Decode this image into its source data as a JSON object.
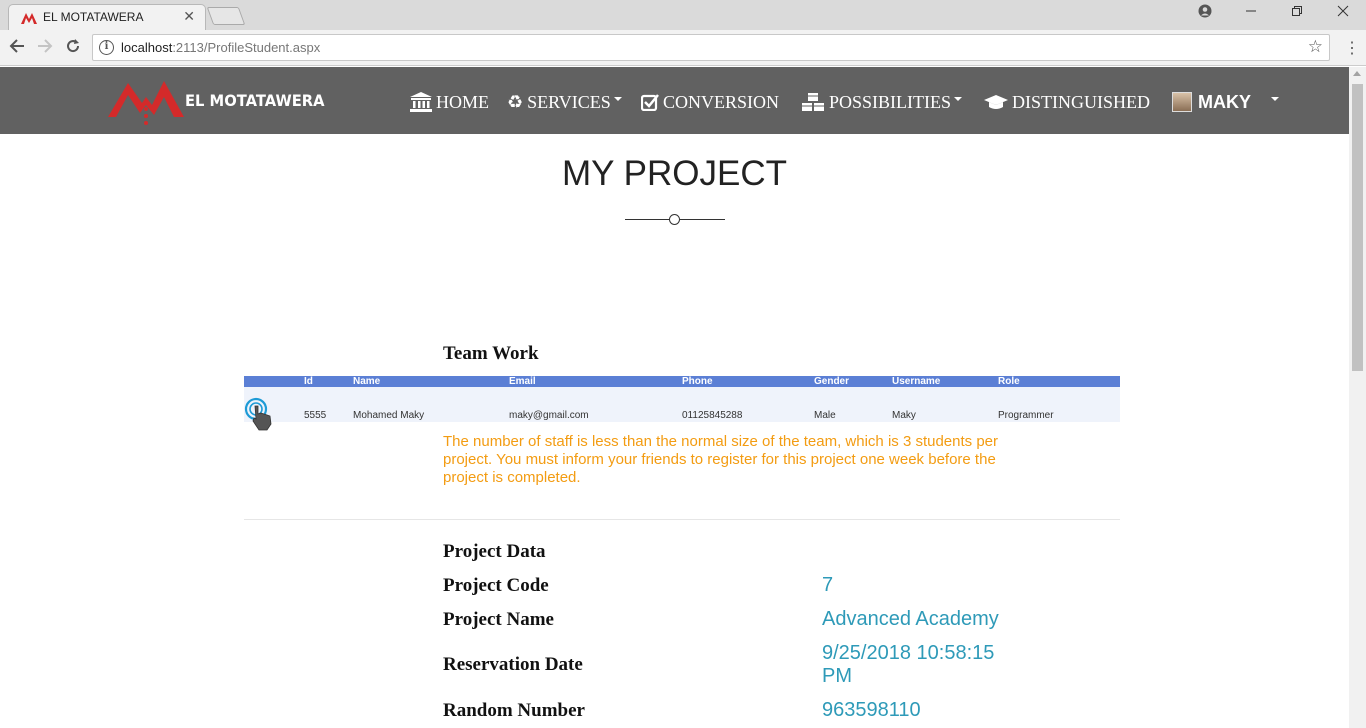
{
  "browser": {
    "tab_title": "EL MOTATAWERA",
    "url_host": "localhost",
    "url_rest": ":2113/ProfileStudent.aspx"
  },
  "site": {
    "brand": "EL MOTATAWERA",
    "brand_color": "#e32b2b",
    "header_bg": "#616161",
    "nav": {
      "home": "HOME",
      "services": "SERVICES",
      "conversion": "CONVERSION",
      "possibilities": "POSSIBILITIES",
      "distinguished": "DISTINGUISHED",
      "user": "MAKY"
    }
  },
  "page": {
    "title": "MY PROJECT",
    "team_heading": "Team Work",
    "team_table": {
      "header_bg": "#5b7fd5",
      "columns": [
        "Id",
        "Name",
        "Email",
        "Phone",
        "Gender",
        "Username",
        "Role"
      ],
      "rows": [
        [
          "5555",
          "Mohamed Maky",
          "maky@gmail.com",
          "01125845288",
          "Male",
          "Maky",
          "Programmer"
        ]
      ]
    },
    "warning": "The number of staff is less than the normal size of the team, which is 3 students per project. You must inform your friends to register for this project one week before the project is completed.",
    "warning_color": "#f39c12",
    "project_heading": "Project Data",
    "project": {
      "code_label": "Project Code",
      "code": "7",
      "name_label": "Project Name",
      "name": "Advanced Academy",
      "date_label": "Reservation Date",
      "date": "9/25/2018 10:58:15 PM",
      "random_label": "Random Number",
      "random": "963598110"
    },
    "value_color": "#2e9ab8"
  }
}
